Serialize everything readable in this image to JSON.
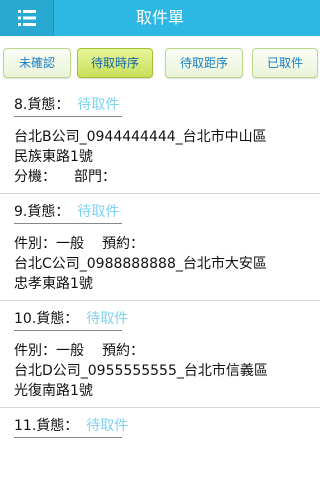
{
  "header": {
    "menu_icon": "list-menu-icon",
    "title": "取件單",
    "color": "#2cb8e3"
  },
  "tabs": [
    {
      "label": "未確認",
      "active": false
    },
    {
      "label": "待取時序",
      "active": true
    },
    {
      "label": "待取距序",
      "active": false
    },
    {
      "label": "已取件",
      "active": false
    }
  ],
  "orders": [
    {
      "number_label": "8.貨態：",
      "status": "待取件",
      "address_line1": "台北B公司_0944444444_台北市中山區",
      "address_line2": "民族東路1號",
      "extension_label": "分機：",
      "department_label": "部門："
    },
    {
      "number_label": "9.貨態：",
      "status": "待取件",
      "type_label": "件別：一般",
      "appointment_label": "預約：",
      "address_line1": "台北C公司_0988888888_台北市大安區",
      "address_line2": "忠孝東路1號"
    },
    {
      "number_label": "10.貨態：",
      "status": "待取件",
      "type_label": "件別：一般",
      "appointment_label": "預約：",
      "address_line1": "台北D公司_0955555555_台北市信義區",
      "address_line2": "光復南路1號"
    },
    {
      "number_label": "11.貨態：",
      "status": "待取件"
    }
  ],
  "colors": {
    "status": "#7fd2f2",
    "tab_active": "#c9e05a",
    "tab_text": "#1a7fc6"
  }
}
